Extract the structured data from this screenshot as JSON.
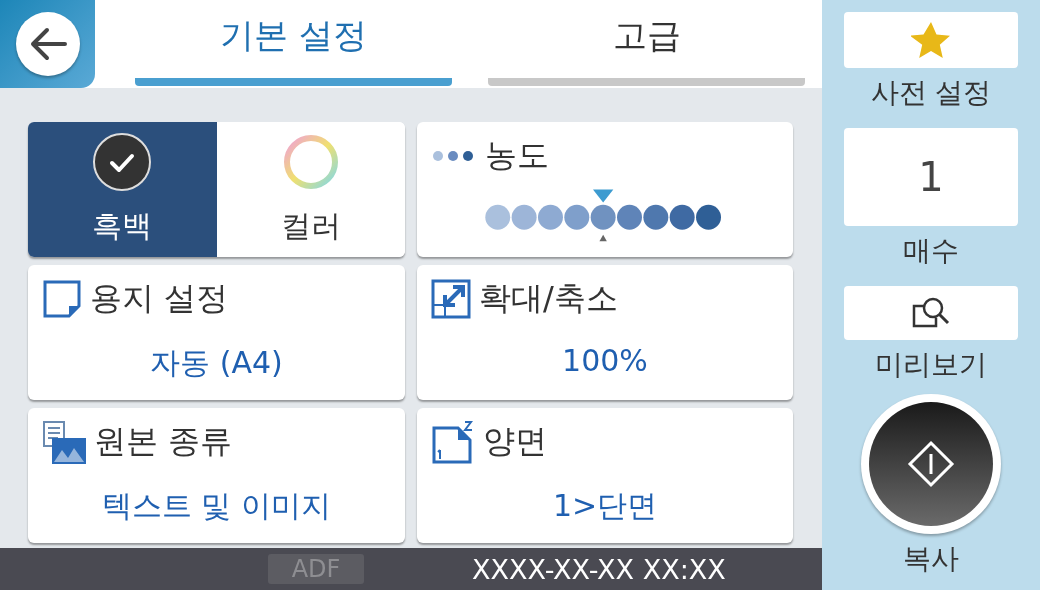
{
  "header": {
    "tabs": [
      {
        "label": "기본 설정",
        "selected": true
      },
      {
        "label": "고급",
        "selected": false
      }
    ]
  },
  "color_mode": {
    "options": [
      {
        "label": "흑백",
        "kind": "mono",
        "selected": true
      },
      {
        "label": "컬러",
        "kind": "color",
        "selected": false
      }
    ]
  },
  "density": {
    "label": "농도",
    "level": 0.5
  },
  "settings": [
    {
      "kind": "paper",
      "label": "용지 설정",
      "value": "자동 (A4)"
    },
    {
      "kind": "zoom",
      "label": "확대/축소",
      "value": "100%"
    },
    {
      "kind": "original",
      "label": "원본 종류",
      "value": "텍스트 및 이미지"
    },
    {
      "kind": "duplex",
      "label": "양면",
      "value": "1>단면"
    }
  ],
  "sidebar": {
    "presets_label": "사전 설정",
    "copies": "1",
    "copies_label": "매수",
    "preview_label": "미리보기",
    "start_label": "복사"
  },
  "status_bar": {
    "source": "ADF",
    "datetime": "XXXX-XX-XX XX:XX"
  }
}
